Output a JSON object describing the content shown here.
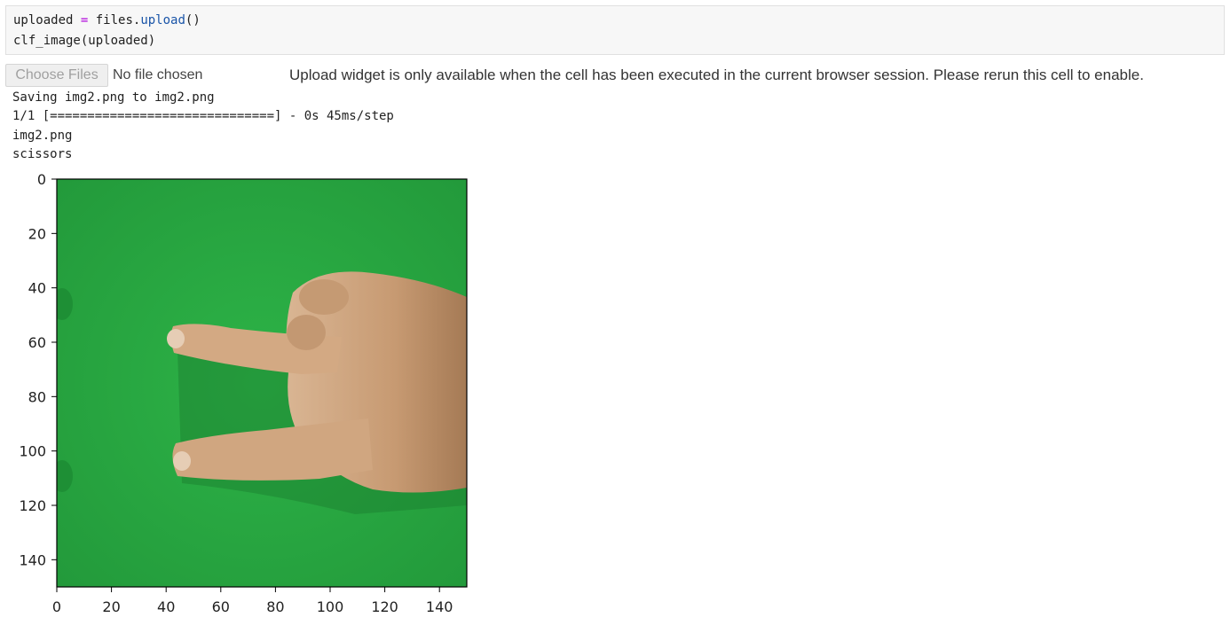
{
  "code_cell": {
    "line1": {
      "var": "uploaded",
      "op": "=",
      "obj": "files.",
      "fn": "upload",
      "tail": "()"
    },
    "line2": "clf_image(uploaded)"
  },
  "upload_widget": {
    "button_label": "Choose Files",
    "file_status": "No file chosen",
    "message": "Upload widget is only available when the cell has been executed in the current browser session. Please rerun this cell to enable."
  },
  "output": {
    "saving": "Saving img2.png to img2.png",
    "progress": "1/1 [==============================] - 0s 45ms/step",
    "filename": "img2.png",
    "prediction": "scissors"
  },
  "plot": {
    "image_description": "hand",
    "x_ticks": [
      "0",
      "20",
      "40",
      "60",
      "80",
      "100",
      "120",
      "140"
    ],
    "y_ticks": [
      "0",
      "20",
      "40",
      "60",
      "80",
      "100",
      "120",
      "140"
    ],
    "xlim": [
      0,
      150
    ],
    "ylim": [
      150,
      0
    ],
    "colors": {
      "background_green": "#25a63c",
      "skin": "#c9a07a",
      "axis": "#000000"
    }
  }
}
